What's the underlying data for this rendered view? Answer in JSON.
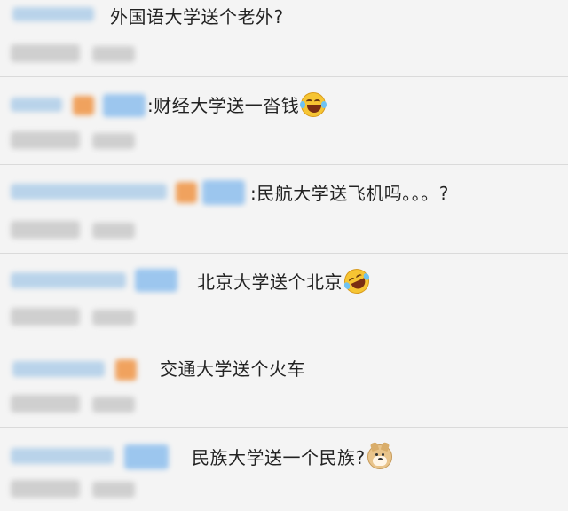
{
  "comments": [
    {
      "text": "外国语大学送个老外?",
      "emoji": ""
    },
    {
      "text": ":财经大学送一沓钱",
      "emoji": "laughing-tears-icon"
    },
    {
      "text": ":民航大学送飞机吗。。。?",
      "emoji": ""
    },
    {
      "text": "北京大学送个北京",
      "emoji": "laughing-tears-icon"
    },
    {
      "text": "交通大学送个火车",
      "emoji": ""
    },
    {
      "text": "民族大学送一个民族?",
      "emoji": "doge-icon"
    }
  ],
  "colors": {
    "background": "#f4f4f4",
    "divider": "#dadada",
    "username_blur": "#b9d3ea",
    "meta_blur": "#cfcfcf"
  }
}
